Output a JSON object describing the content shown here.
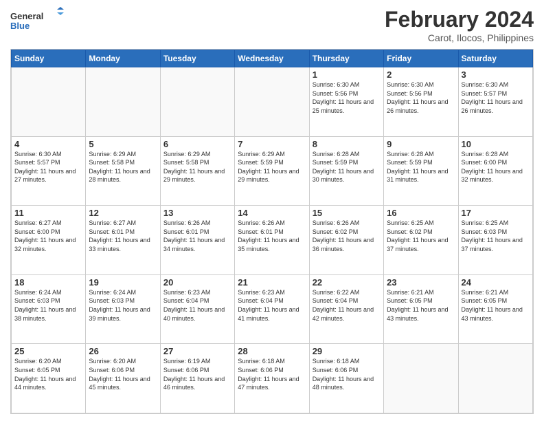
{
  "header": {
    "logo_general": "General",
    "logo_blue": "Blue",
    "main_title": "February 2024",
    "subtitle": "Carot, Ilocos, Philippines"
  },
  "days_of_week": [
    "Sunday",
    "Monday",
    "Tuesday",
    "Wednesday",
    "Thursday",
    "Friday",
    "Saturday"
  ],
  "weeks": [
    [
      {
        "day": "",
        "info": ""
      },
      {
        "day": "",
        "info": ""
      },
      {
        "day": "",
        "info": ""
      },
      {
        "day": "",
        "info": ""
      },
      {
        "day": "1",
        "info": "Sunrise: 6:30 AM\nSunset: 5:56 PM\nDaylight: 11 hours and 25 minutes."
      },
      {
        "day": "2",
        "info": "Sunrise: 6:30 AM\nSunset: 5:56 PM\nDaylight: 11 hours and 26 minutes."
      },
      {
        "day": "3",
        "info": "Sunrise: 6:30 AM\nSunset: 5:57 PM\nDaylight: 11 hours and 26 minutes."
      }
    ],
    [
      {
        "day": "4",
        "info": "Sunrise: 6:30 AM\nSunset: 5:57 PM\nDaylight: 11 hours and 27 minutes."
      },
      {
        "day": "5",
        "info": "Sunrise: 6:29 AM\nSunset: 5:58 PM\nDaylight: 11 hours and 28 minutes."
      },
      {
        "day": "6",
        "info": "Sunrise: 6:29 AM\nSunset: 5:58 PM\nDaylight: 11 hours and 29 minutes."
      },
      {
        "day": "7",
        "info": "Sunrise: 6:29 AM\nSunset: 5:59 PM\nDaylight: 11 hours and 29 minutes."
      },
      {
        "day": "8",
        "info": "Sunrise: 6:28 AM\nSunset: 5:59 PM\nDaylight: 11 hours and 30 minutes."
      },
      {
        "day": "9",
        "info": "Sunrise: 6:28 AM\nSunset: 5:59 PM\nDaylight: 11 hours and 31 minutes."
      },
      {
        "day": "10",
        "info": "Sunrise: 6:28 AM\nSunset: 6:00 PM\nDaylight: 11 hours and 32 minutes."
      }
    ],
    [
      {
        "day": "11",
        "info": "Sunrise: 6:27 AM\nSunset: 6:00 PM\nDaylight: 11 hours and 32 minutes."
      },
      {
        "day": "12",
        "info": "Sunrise: 6:27 AM\nSunset: 6:01 PM\nDaylight: 11 hours and 33 minutes."
      },
      {
        "day": "13",
        "info": "Sunrise: 6:26 AM\nSunset: 6:01 PM\nDaylight: 11 hours and 34 minutes."
      },
      {
        "day": "14",
        "info": "Sunrise: 6:26 AM\nSunset: 6:01 PM\nDaylight: 11 hours and 35 minutes."
      },
      {
        "day": "15",
        "info": "Sunrise: 6:26 AM\nSunset: 6:02 PM\nDaylight: 11 hours and 36 minutes."
      },
      {
        "day": "16",
        "info": "Sunrise: 6:25 AM\nSunset: 6:02 PM\nDaylight: 11 hours and 37 minutes."
      },
      {
        "day": "17",
        "info": "Sunrise: 6:25 AM\nSunset: 6:03 PM\nDaylight: 11 hours and 37 minutes."
      }
    ],
    [
      {
        "day": "18",
        "info": "Sunrise: 6:24 AM\nSunset: 6:03 PM\nDaylight: 11 hours and 38 minutes."
      },
      {
        "day": "19",
        "info": "Sunrise: 6:24 AM\nSunset: 6:03 PM\nDaylight: 11 hours and 39 minutes."
      },
      {
        "day": "20",
        "info": "Sunrise: 6:23 AM\nSunset: 6:04 PM\nDaylight: 11 hours and 40 minutes."
      },
      {
        "day": "21",
        "info": "Sunrise: 6:23 AM\nSunset: 6:04 PM\nDaylight: 11 hours and 41 minutes."
      },
      {
        "day": "22",
        "info": "Sunrise: 6:22 AM\nSunset: 6:04 PM\nDaylight: 11 hours and 42 minutes."
      },
      {
        "day": "23",
        "info": "Sunrise: 6:21 AM\nSunset: 6:05 PM\nDaylight: 11 hours and 43 minutes."
      },
      {
        "day": "24",
        "info": "Sunrise: 6:21 AM\nSunset: 6:05 PM\nDaylight: 11 hours and 43 minutes."
      }
    ],
    [
      {
        "day": "25",
        "info": "Sunrise: 6:20 AM\nSunset: 6:05 PM\nDaylight: 11 hours and 44 minutes."
      },
      {
        "day": "26",
        "info": "Sunrise: 6:20 AM\nSunset: 6:06 PM\nDaylight: 11 hours and 45 minutes."
      },
      {
        "day": "27",
        "info": "Sunrise: 6:19 AM\nSunset: 6:06 PM\nDaylight: 11 hours and 46 minutes."
      },
      {
        "day": "28",
        "info": "Sunrise: 6:18 AM\nSunset: 6:06 PM\nDaylight: 11 hours and 47 minutes."
      },
      {
        "day": "29",
        "info": "Sunrise: 6:18 AM\nSunset: 6:06 PM\nDaylight: 11 hours and 48 minutes."
      },
      {
        "day": "",
        "info": ""
      },
      {
        "day": "",
        "info": ""
      }
    ]
  ]
}
